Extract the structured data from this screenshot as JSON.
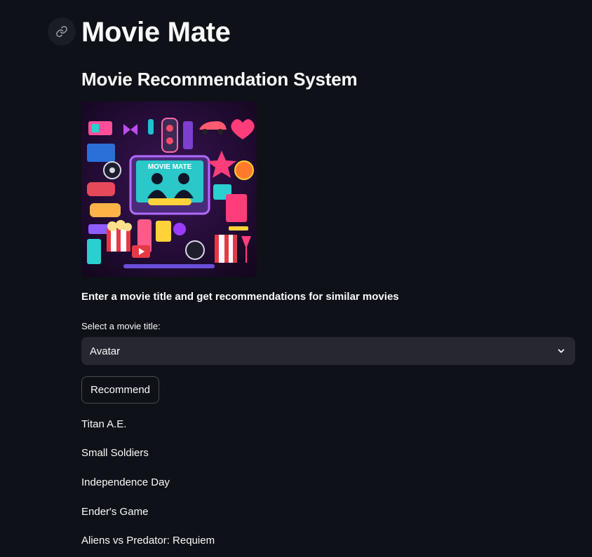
{
  "app": {
    "title": "Movie Mate",
    "subtitle": "Movie Recommendation System",
    "image_banner_text": "MOVIE MATE",
    "instruction": "Enter a movie title and get recommendations for similar movies"
  },
  "select": {
    "label": "Select a movie title:",
    "value": "Avatar"
  },
  "button": {
    "label": "Recommend"
  },
  "recommendations": [
    "Titan A.E.",
    "Small Soldiers",
    "Independence Day",
    "Ender's Game",
    "Aliens vs Predator: Requiem"
  ],
  "colors": {
    "background": "#0e1117",
    "input_background": "#262730",
    "text": "#fafafa"
  },
  "icons": {
    "anchor": "link-icon",
    "dropdown": "chevron-down-icon"
  }
}
